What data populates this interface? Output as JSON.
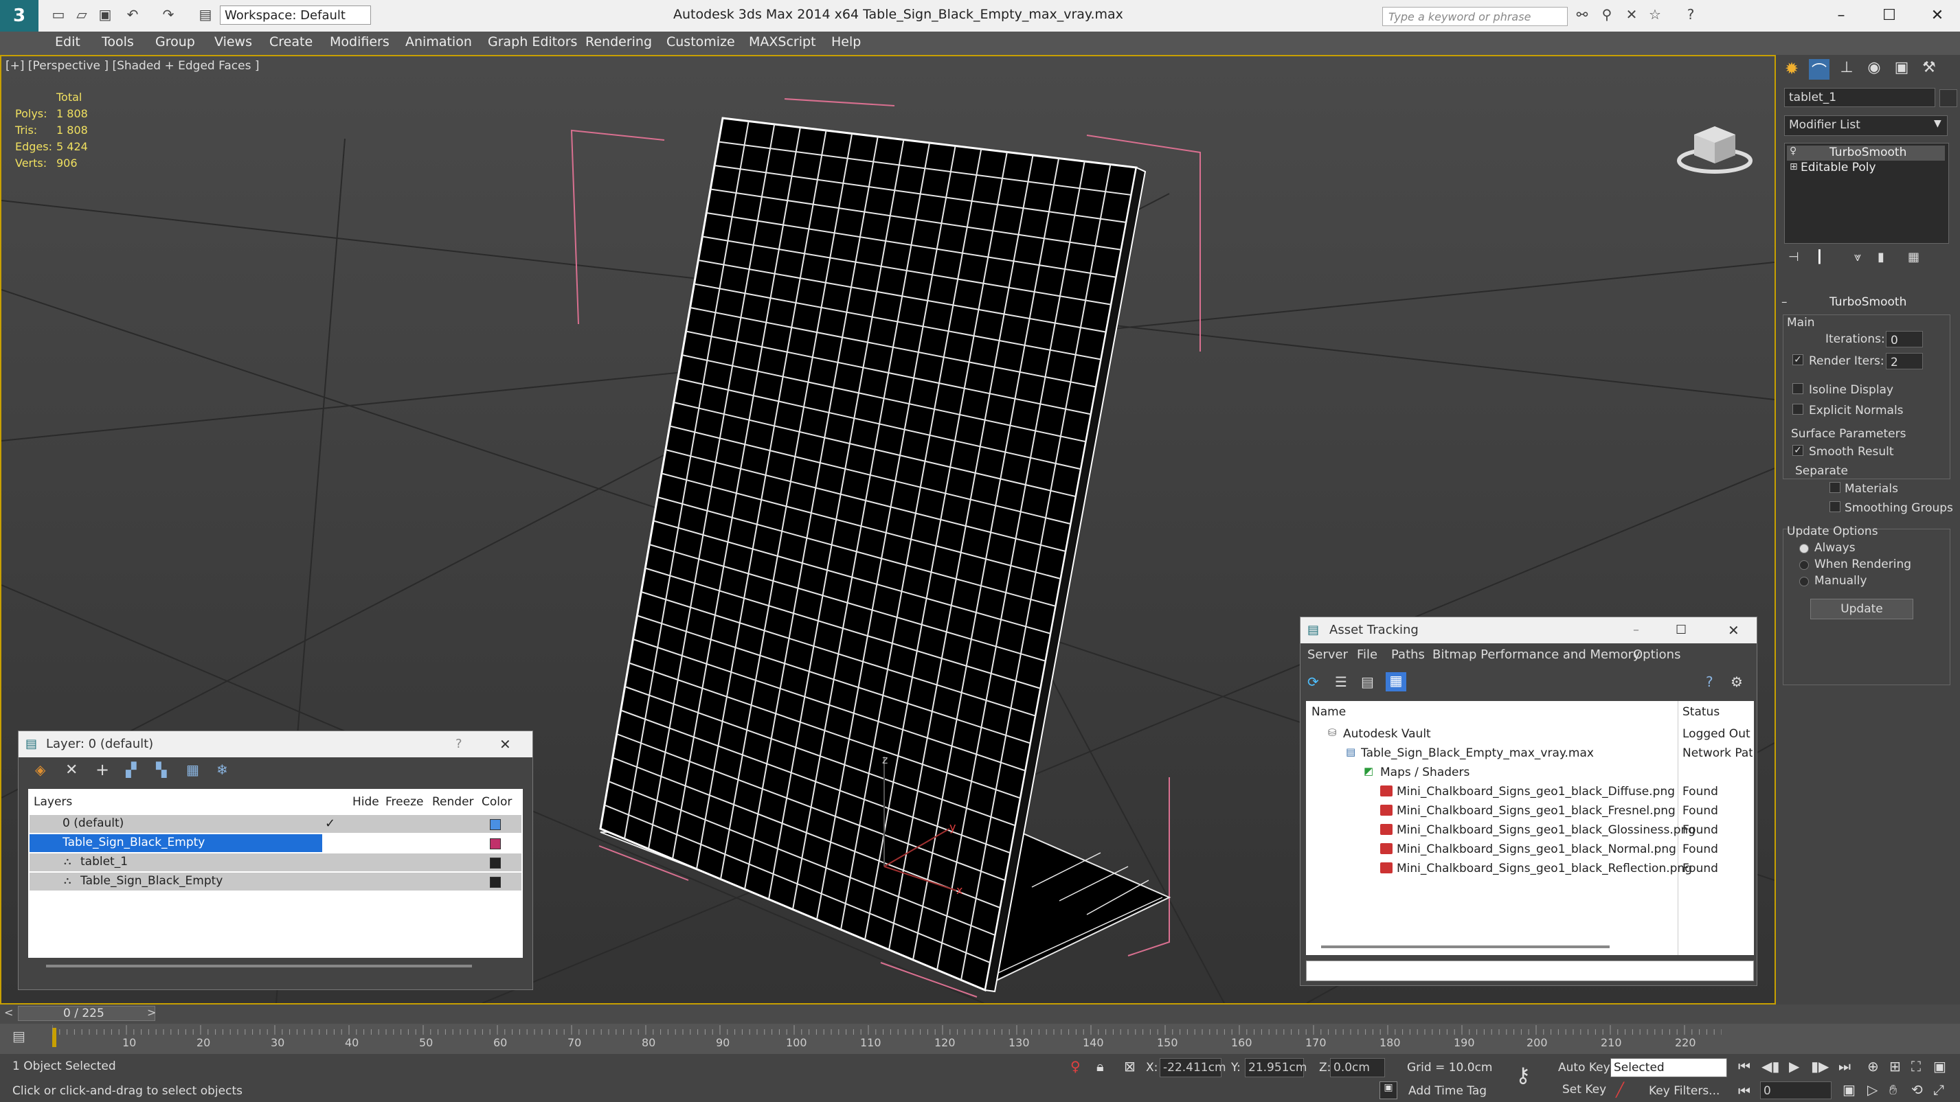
{
  "titlebar": {
    "title": "Autodesk 3ds Max  2014 x64      Table_Sign_Black_Empty_max_vray.max",
    "workspace": "Workspace: Default",
    "search_placeholder": "Type a keyword or phrase"
  },
  "menubar": [
    "Edit",
    "Tools",
    "Group",
    "Views",
    "Create",
    "Modifiers",
    "Animation",
    "Graph Editors",
    "Rendering",
    "Customize",
    "MAXScript",
    "Help"
  ],
  "viewport": {
    "label": "[+] [Perspective ] [Shaded + Edged Faces ]",
    "stats": {
      "total_label": "Total",
      "rows": [
        {
          "label": "Polys:",
          "value": "1 808"
        },
        {
          "label": "Tris:",
          "value": "1 808"
        },
        {
          "label": "Edges:",
          "value": "5 424"
        },
        {
          "label": "Verts:",
          "value": "906"
        }
      ]
    },
    "axis_labels": {
      "x": "x",
      "y": "y",
      "z": "z"
    }
  },
  "command_panel": {
    "object_name": "tablet_1",
    "modifier_list": "Modifier List",
    "stack": [
      "TurboSmooth",
      "Editable Poly"
    ],
    "rollout_title": "TurboSmooth",
    "main_label": "Main",
    "iterations_label": "Iterations:",
    "iterations_value": "0",
    "render_iters_label": "Render Iters:",
    "render_iters_value": "2",
    "render_iters_checked": true,
    "isoline_label": "Isoline Display",
    "explicit_normals_label": "Explicit Normals",
    "surface_params_label": "Surface Parameters",
    "smooth_result_label": "Smooth Result",
    "smooth_result_checked": true,
    "separate_label": "Separate",
    "materials_label": "Materials",
    "smoothing_groups_label": "Smoothing Groups",
    "update_options_label": "Update Options",
    "always_label": "Always",
    "when_rendering_label": "When Rendering",
    "manually_label": "Manually",
    "update_button": "Update"
  },
  "layer_dialog": {
    "title": "Layer: 0 (default)",
    "help": "?",
    "columns": [
      "Layers",
      "Hide",
      "Freeze",
      "Render",
      "Color"
    ],
    "rows": [
      {
        "name": "0 (default)",
        "color": "#4a90e2",
        "selected": false
      },
      {
        "name": "Table_Sign_Black_Empty",
        "color": "#c0306a",
        "selected": true
      },
      {
        "name": "tablet_1",
        "color": "#222222",
        "selected": false
      },
      {
        "name": "Table_Sign_Black_Empty",
        "color": "#222222",
        "selected": false
      }
    ]
  },
  "asset_tracking": {
    "title": "Asset Tracking",
    "menu": [
      "Server",
      "File",
      "Paths",
      "Bitmap Performance and Memory",
      "Options"
    ],
    "columns": [
      "Name",
      "Status"
    ],
    "rows": [
      {
        "name": "Autodesk Vault",
        "status": "Logged Out"
      },
      {
        "name": "Table_Sign_Black_Empty_max_vray.max",
        "status": "Network Pat"
      },
      {
        "name": "Maps / Shaders",
        "status": ""
      },
      {
        "name": "Mini_Chalkboard_Signs_geo1_black_Diffuse.png",
        "status": "Found"
      },
      {
        "name": "Mini_Chalkboard_Signs_geo1_black_Fresnel.png",
        "status": "Found"
      },
      {
        "name": "Mini_Chalkboard_Signs_geo1_black_Glossiness.png",
        "status": "Found"
      },
      {
        "name": "Mini_Chalkboard_Signs_geo1_black_Normal.png",
        "status": "Found"
      },
      {
        "name": "Mini_Chalkboard_Signs_geo1_black_Reflection.png",
        "status": "Found"
      }
    ]
  },
  "timeline": {
    "frame": "0 / 225",
    "ticks": [
      "10",
      "20",
      "30",
      "40",
      "50",
      "60",
      "70",
      "80",
      "90",
      "100",
      "110",
      "120",
      "130",
      "140",
      "150",
      "160",
      "170",
      "180",
      "190",
      "200",
      "210",
      "220"
    ]
  },
  "status": {
    "selected": "1 Object Selected",
    "prompt": "Click or click-and-drag to select objects",
    "x_label": "X:",
    "x_value": "-22.411cm",
    "y_label": "Y:",
    "y_value": "21.951cm",
    "z_label": "Z:",
    "z_value": "0.0cm",
    "grid": "Grid = 10.0cm",
    "auto_key": "Auto Key",
    "auto_key_value": "Selected",
    "set_key": "Set Key",
    "key_filters": "Key Filters...",
    "add_time_tag": "Add Time Tag",
    "frame_field": "0"
  }
}
